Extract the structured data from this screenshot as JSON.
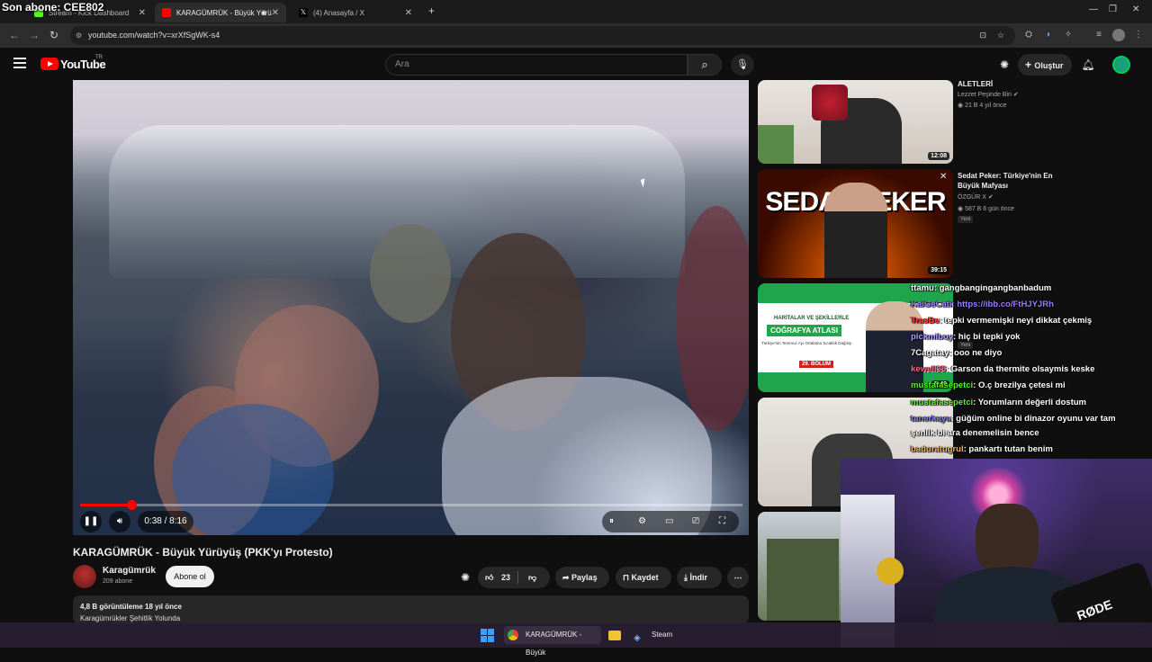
{
  "overlay": {
    "subscriber_text": "Son abone: CEE802"
  },
  "browser": {
    "tabs": [
      {
        "label": "Stream - Kick Dashboard",
        "color": "#53fc18"
      },
      {
        "label": "KARAGÜMRÜK - Büyük Yürü",
        "color": "#ff0000"
      },
      {
        "label": "(4) Anasayfa / X",
        "color": "#ffffff"
      }
    ],
    "new_tab": "+",
    "url": "youtube.com/watch?v=xrXfSgWK-s4"
  },
  "youtube": {
    "wordmark": "YouTube",
    "country": "TR",
    "search_placeholder": "Ara",
    "create_label": "Oluştur"
  },
  "player": {
    "time": "0:38 / 8:16",
    "progress": 0.077
  },
  "video": {
    "title": "KARAGÜMRÜK - Büyük Yürüyüş (PKK'yı Protesto)",
    "channel": "Karagümrük",
    "subscribers": "209 abone",
    "subscribe_label": "Abone ol",
    "likes": "23",
    "share_label": "Paylaş",
    "save_label": "Kaydet",
    "download_label": "İndir",
    "views_date": "4,8 B görüntüleme  18 yıl önce",
    "desc_line2": "Karagümrükler Şehitlik Yolunda"
  },
  "recommendations": [
    {
      "title": "ALETLERİ",
      "channel": "Lezzet Peşinde Biri",
      "meta": "21 B  4 yıl önce",
      "duration": "12:08",
      "badge": ""
    },
    {
      "title": "Sedat Peker: Türkiye'nin En Büyük Mafyası",
      "channel": "ÖZGÜR X",
      "meta": "587 B  6 gün önce",
      "duration": "39:15",
      "badge": "Yeni",
      "thumb_text": "SEDAT PEKER"
    },
    {
      "title": "Harita ve Şekillerle Coğrafya",
      "channel": "",
      "meta": "",
      "duration": "5:40",
      "badge": "Yeni",
      "thumb_text_1": "HARİTALAR VE ŞEKİLLERLE",
      "thumb_text_2": "COĞRAFYA ATLASI",
      "thumb_text_3": "Türkiye'nin Temmuz Ayı Ortalama Sıcaklık Dağılışı",
      "thumb_text_4": "29. BÖLÜM"
    },
    {
      "title": "",
      "channel": "",
      "meta": "",
      "duration": "",
      "badge": ""
    },
    {
      "title": "",
      "channel": "",
      "meta": "",
      "duration": "",
      "badge": ""
    }
  ],
  "chat": [
    {
      "user": "ttamu",
      "user_color": "#ffffff",
      "text": ": gangbangingangbanbadum"
    },
    {
      "user": "KaiGeCati",
      "user_color": "#9b7bff",
      "text": ": https://ibb.co/FtHJYJRh"
    },
    {
      "user": "TrasBe",
      "user_color": "#ff4444",
      "text": ": tepki vermemişki neyi dikkat çekmiş"
    },
    {
      "user": "pickmiboy",
      "user_color": "#b0a0ff",
      "text": ": hiç bi tepki yok"
    },
    {
      "user": "7Cagatay",
      "user_color": "#ffffff",
      "text": ": ooo ne diyo"
    },
    {
      "user": "kewell35",
      "user_color": "#ff6b8a",
      "text": ": Garson da thermite olsaymis keske"
    },
    {
      "user": "mustafasepetci",
      "user_color": "#53fc18",
      "text": ": O.ç brezilya çetesi mi"
    },
    {
      "user": "mustafasepetci",
      "user_color": "#53fc18",
      "text": ": Yorumların değerli dostum"
    },
    {
      "user": "tanerkaya",
      "user_color": "#8a7bff",
      "text": ": güğüm online bi dinazor oyunu var tam"
    },
    {
      "user": "",
      "user_color": "#ffffff",
      "text": "şenlik bi ara denemelisin bence"
    },
    {
      "user": "baduratugrul",
      "user_color": "#ffb347",
      "text": ": pankartı tutan benim"
    }
  ],
  "taskbar": {
    "chrome_label": "KARAGÜMRÜK - Büyük",
    "steam_label": "Steam"
  },
  "webcam": {
    "mic_brand": "RØDE"
  }
}
